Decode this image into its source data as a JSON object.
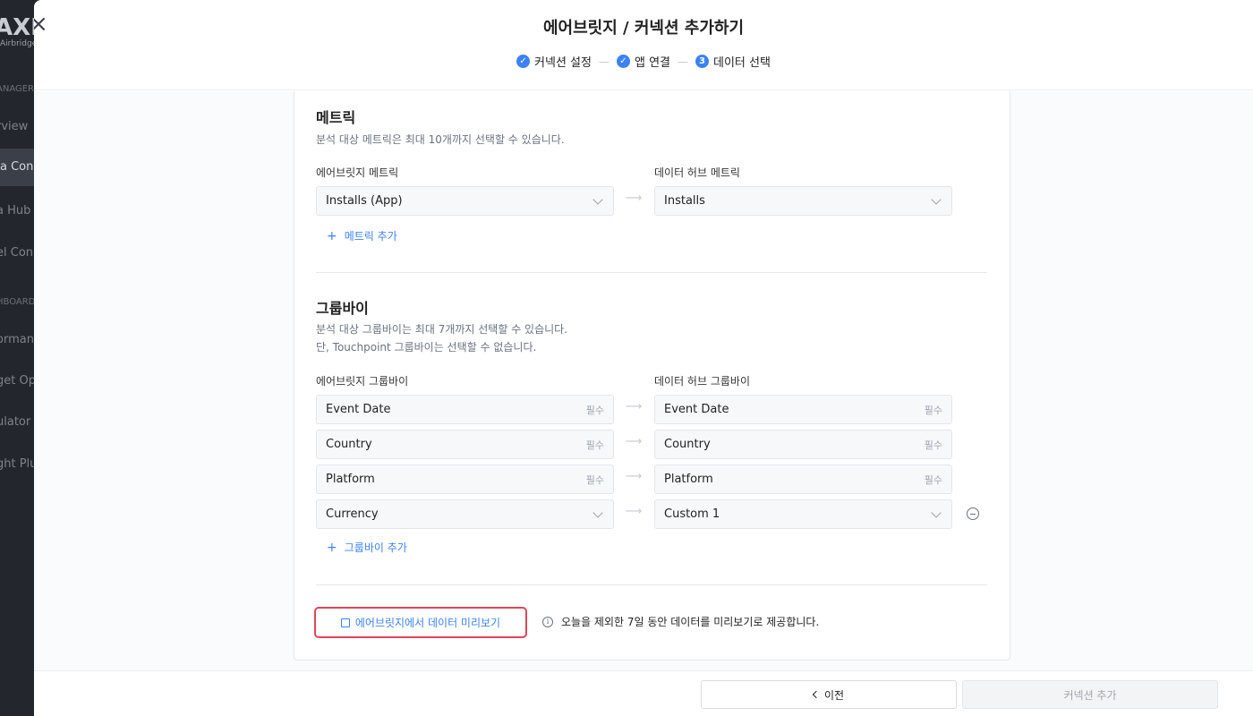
{
  "background_sidebar": {
    "logo": "AXM",
    "logo_sub": "Airbridge",
    "items": [
      {
        "label": "ANAGER",
        "top": 0
      },
      {
        "label": "rview"
      },
      {
        "label": "a Conn"
      },
      {
        "label": "a Hub"
      },
      {
        "label": "el Con"
      },
      {
        "label": "HBOARD"
      },
      {
        "label": "ormance"
      },
      {
        "label": "get Op"
      },
      {
        "label": "ulator"
      },
      {
        "label": "ght Plu"
      }
    ]
  },
  "modal": {
    "title": "에어브릿지 / 커넥션 추가하기",
    "close_icon": "×",
    "steps": [
      {
        "label": "커넥션 설정",
        "icon": "✓"
      },
      {
        "label": "앱 연결",
        "icon": "✓"
      },
      {
        "label": "데이터 선택",
        "icon": "3"
      }
    ],
    "step_separator": "—"
  },
  "metric_section": {
    "title": "메트릭",
    "desc": "분석 대상 메트릭은 최대 10개까지 선택할 수 있습니다.",
    "left_label": "에어브릿지 메트릭",
    "right_label": "데이터 허브 메트릭",
    "rows": [
      {
        "left": "Installs (App)",
        "right": "Installs"
      }
    ],
    "add_label": "메트릭 추가"
  },
  "groupby_section": {
    "title": "그룹바이",
    "desc_line1": "분석 대상 그룹바이는 최대 7개까지 선택할 수 있습니다.",
    "desc_line2": "단, Touchpoint 그룹바이는 선택할 수 없습니다.",
    "left_label": "에어브릿지 그룹바이",
    "right_label": "데이터 허브 그룹바이",
    "required_label": "필수",
    "rows": [
      {
        "left": "Event Date",
        "right": "Event Date"
      },
      {
        "left": "Country",
        "right": "Country"
      },
      {
        "left": "Platform",
        "right": "Platform"
      },
      {
        "left": "Currency",
        "right": "Custom 1"
      }
    ],
    "add_label": "그룹바이 추가"
  },
  "arrow": "⟶",
  "plus": "+",
  "preview": {
    "button_label": "에어브릿지에서 데이터 미리보기",
    "info_icon": "i",
    "info_text": "오늘을 제외한 7일 동안 데이터를 미리보기로 제공합니다."
  },
  "footer": {
    "prev_label": "이전",
    "add_label": "커넥션 추가"
  },
  "colors": {
    "accent": "#3b82f6",
    "highlight_border": "#e0455a"
  }
}
